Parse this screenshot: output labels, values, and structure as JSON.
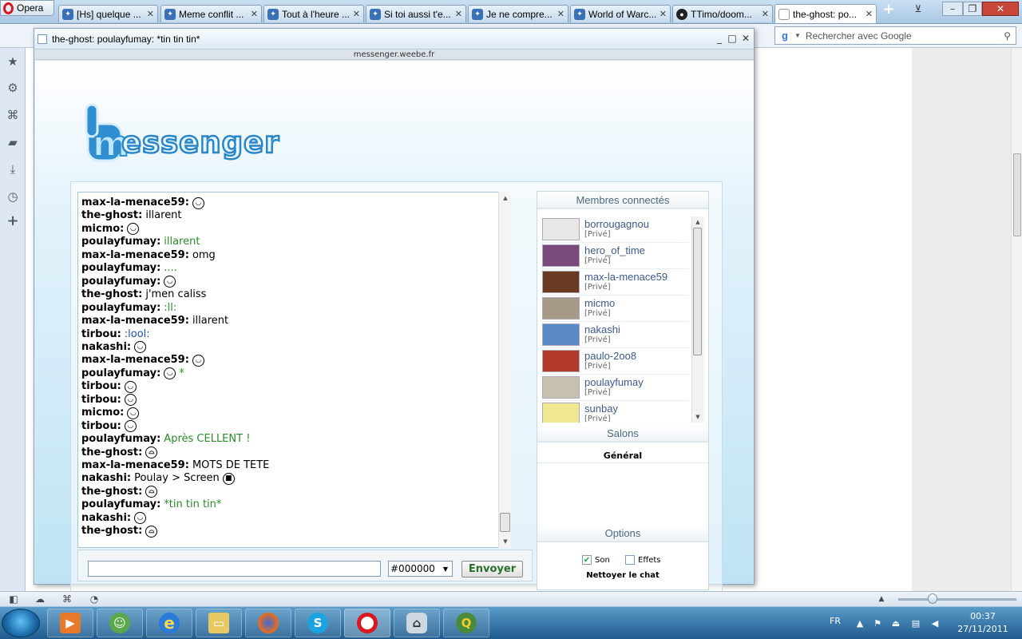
{
  "browser": {
    "menu_label": "Opera",
    "tabs": [
      {
        "label": "[Hs] quelque ..."
      },
      {
        "label": "Meme conflit ..."
      },
      {
        "label": "Tout à l'heure ..."
      },
      {
        "label": "Si toi aussi t'e..."
      },
      {
        "label": "Je ne compre..."
      },
      {
        "label": "World of Warc..."
      },
      {
        "label": "TTimo/doom..."
      },
      {
        "label": "the-ghost: po..."
      }
    ],
    "search_placeholder": "Rechercher avec Google"
  },
  "popup": {
    "title": "the-ghost: poulayfumay: *tin tin tin*",
    "url": "messenger.weebe.fr",
    "logo_text": "messenger"
  },
  "chat": {
    "messages": [
      {
        "nick": "max-la-menace59:",
        "text": "",
        "smiley": "laugh"
      },
      {
        "nick": "the-ghost:",
        "text": "illarent",
        "color": "black"
      },
      {
        "nick": "micmo:",
        "text": "",
        "smiley": "laugh"
      },
      {
        "nick": "poulayfumay:",
        "text": "illarent",
        "color": "green"
      },
      {
        "nick": "max-la-menace59:",
        "text": "omg",
        "color": "black"
      },
      {
        "nick": "poulayfumay:",
        "text": "....",
        "color": "green"
      },
      {
        "nick": "poulayfumay:",
        "text": "",
        "smiley": "laugh"
      },
      {
        "nick": "the-ghost:",
        "text": "j'men caliss",
        "color": "black"
      },
      {
        "nick": "poulayfumay:",
        "text": ":ll:",
        "color": "green"
      },
      {
        "nick": "max-la-menace59:",
        "text": "illarent",
        "color": "black"
      },
      {
        "nick": "tirbou:",
        "text": ":lool:",
        "color": "blue"
      },
      {
        "nick": "nakashi:",
        "text": "",
        "smiley": "laugh"
      },
      {
        "nick": "max-la-menace59:",
        "text": "",
        "smiley": "laugh"
      },
      {
        "nick": "poulayfumay:",
        "text": "*",
        "color": "green",
        "smiley": "laugh"
      },
      {
        "nick": "tirbou:",
        "text": "",
        "smiley": "laugh"
      },
      {
        "nick": "tirbou:",
        "text": "",
        "smiley": "laugh"
      },
      {
        "nick": "micmo:",
        "text": "",
        "smiley": "laugh"
      },
      {
        "nick": "tirbou:",
        "text": "",
        "smiley": "laugh"
      },
      {
        "nick": "poulayfumay:",
        "text": "Après CELLENT !",
        "color": "green"
      },
      {
        "nick": "the-ghost:",
        "text": "",
        "smiley": "cry"
      },
      {
        "nick": "max-la-menace59:",
        "text": "MOTS DE TETE",
        "color": "black"
      },
      {
        "nick": "nakashi:",
        "text": "Poulay > Screen",
        "color": "black",
        "smiley": "cool"
      },
      {
        "nick": "the-ghost:",
        "text": "",
        "smiley": "cry"
      },
      {
        "nick": "poulayfumay:",
        "text": "*tin tin tin*",
        "color": "green"
      },
      {
        "nick": "nakashi:",
        "text": "",
        "smiley": "laugh"
      },
      {
        "nick": "the-ghost:",
        "text": "",
        "smiley": "cry"
      }
    ],
    "input_value": "",
    "color_value": "#000000",
    "send_label": "Envoyer"
  },
  "members": {
    "header": "Membres connectés",
    "items": [
      {
        "name": "borrougagnou",
        "tag": "[Privé]",
        "avatar_color": "#e8e8e8"
      },
      {
        "name": "hero_of_time",
        "tag": "[Privé]",
        "avatar_color": "#7a4a7a"
      },
      {
        "name": "max-la-menace59",
        "tag": "[Privé]",
        "avatar_color": "#6b3a22"
      },
      {
        "name": "micmo",
        "tag": "[Privé]",
        "avatar_color": "#a89a88"
      },
      {
        "name": "nakashi",
        "tag": "[Privé]",
        "avatar_color": "#5a8ac8"
      },
      {
        "name": "paulo-2oo8",
        "tag": "[Privé]",
        "avatar_color": "#b23a2a"
      },
      {
        "name": "poulayfumay",
        "tag": "[Privé]",
        "avatar_color": "#c8c0b0"
      },
      {
        "name": "sunbay",
        "tag": "[Privé]",
        "avatar_color": "#f0e890"
      }
    ]
  },
  "salons": {
    "header": "Salons",
    "items": [
      {
        "label": "Général"
      }
    ]
  },
  "options": {
    "header": "Options",
    "son_label": "Son",
    "son_checked": true,
    "effets_label": "Effets",
    "effets_checked": false,
    "clear_label": "Nettoyer le chat"
  },
  "taskbar": {
    "lang": "FR",
    "time": "00:37",
    "date": "27/11/2011"
  }
}
